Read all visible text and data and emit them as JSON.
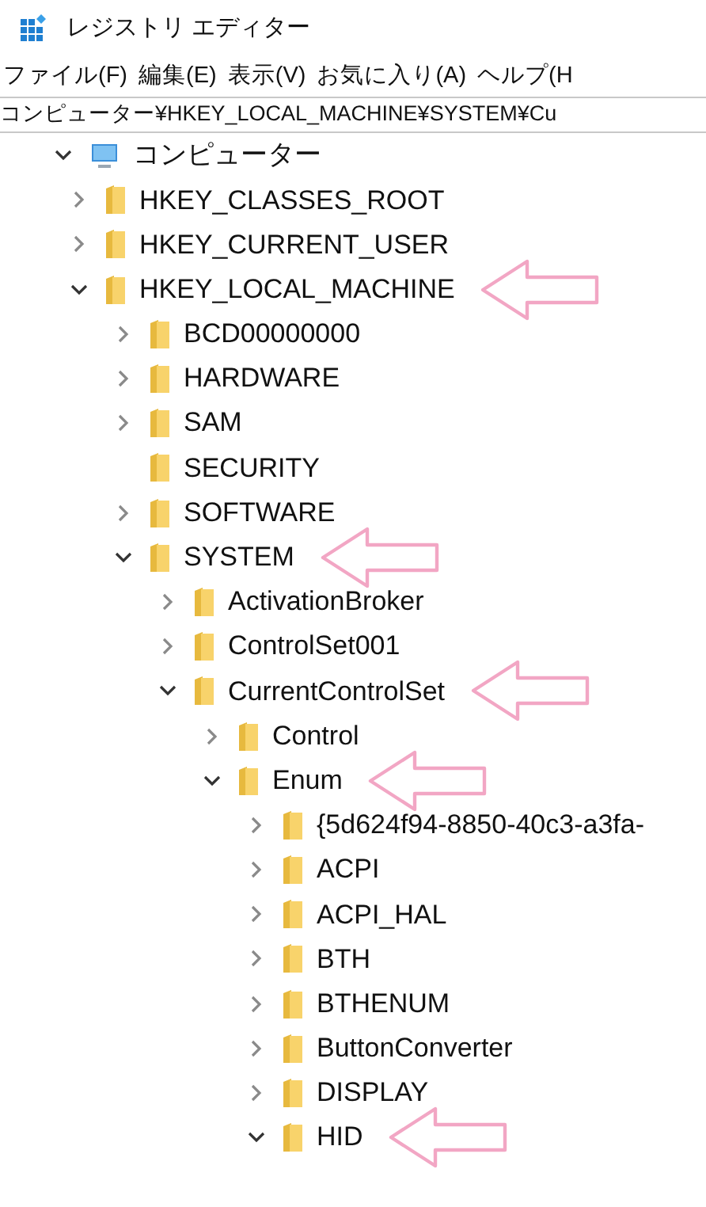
{
  "window": {
    "title": "レジストリ エディター"
  },
  "menu": [
    "ファイル(F)",
    "編集(E)",
    "表示(V)",
    "お気に入り(A)",
    "ヘルプ(H"
  ],
  "address": "コンピューター¥HKEY_LOCAL_MACHINE¥SYSTEM¥Cu",
  "tree": [
    {
      "label": "コンピューター",
      "kind": "computer",
      "expanded": true,
      "marked": false,
      "children": [
        {
          "label": "HKEY_CLASSES_ROOT",
          "kind": "folder",
          "expanded": false,
          "marked": false
        },
        {
          "label": "HKEY_CURRENT_USER",
          "kind": "folder",
          "expanded": false,
          "marked": false
        },
        {
          "label": "HKEY_LOCAL_MACHINE",
          "kind": "folder",
          "expanded": true,
          "marked": true,
          "children": [
            {
              "label": "BCD00000000",
              "kind": "folder",
              "expanded": false,
              "marked": false
            },
            {
              "label": "HARDWARE",
              "kind": "folder",
              "expanded": false,
              "marked": false
            },
            {
              "label": "SAM",
              "kind": "folder",
              "expanded": false,
              "marked": false
            },
            {
              "label": "SECURITY",
              "kind": "leaf",
              "marked": false
            },
            {
              "label": "SOFTWARE",
              "kind": "folder",
              "expanded": false,
              "marked": false
            },
            {
              "label": "SYSTEM",
              "kind": "folder",
              "expanded": true,
              "marked": true,
              "children": [
                {
                  "label": "ActivationBroker",
                  "kind": "folder",
                  "expanded": false,
                  "marked": false
                },
                {
                  "label": "ControlSet001",
                  "kind": "folder",
                  "expanded": false,
                  "marked": false
                },
                {
                  "label": "CurrentControlSet",
                  "kind": "folder",
                  "expanded": true,
                  "marked": true,
                  "children": [
                    {
                      "label": "Control",
                      "kind": "folder",
                      "expanded": false,
                      "marked": false
                    },
                    {
                      "label": "Enum",
                      "kind": "folder",
                      "expanded": true,
                      "marked": true,
                      "children": [
                        {
                          "label": "{5d624f94-8850-40c3-a3fa-",
                          "kind": "folder",
                          "expanded": false,
                          "marked": false
                        },
                        {
                          "label": "ACPI",
                          "kind": "folder",
                          "expanded": false,
                          "marked": false
                        },
                        {
                          "label": "ACPI_HAL",
                          "kind": "folder",
                          "expanded": false,
                          "marked": false
                        },
                        {
                          "label": "BTH",
                          "kind": "folder",
                          "expanded": false,
                          "marked": false
                        },
                        {
                          "label": "BTHENUM",
                          "kind": "folder",
                          "expanded": false,
                          "marked": false
                        },
                        {
                          "label": "ButtonConverter",
                          "kind": "folder",
                          "expanded": false,
                          "marked": false
                        },
                        {
                          "label": "DISPLAY",
                          "kind": "folder",
                          "expanded": false,
                          "marked": false
                        },
                        {
                          "label": "HID",
                          "kind": "folder",
                          "expanded": true,
                          "marked": true
                        }
                      ]
                    }
                  ]
                }
              ]
            }
          ]
        }
      ]
    }
  ]
}
